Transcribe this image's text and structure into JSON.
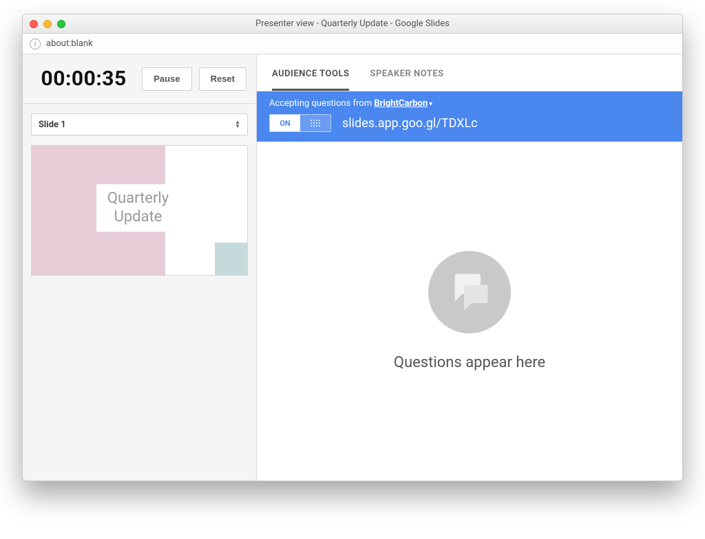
{
  "window": {
    "title": "Presenter view - Quarterly Update - Google Slides"
  },
  "addressbar": {
    "url": "about:blank"
  },
  "left": {
    "timer": "00:00:35",
    "pause_label": "Pause",
    "reset_label": "Reset",
    "slide_selector": "Slide 1",
    "thumbnail_title_line1": "Quarterly",
    "thumbnail_title_line2": "Update"
  },
  "tabs": {
    "audience": "AUDIENCE TOOLS",
    "notes": "SPEAKER NOTES"
  },
  "banner": {
    "accepting_prefix": "Accepting questions from",
    "organization": "BrightCarbon",
    "toggle_on": "ON",
    "share_url": "slides.app.goo.gl/TDXLc"
  },
  "questions": {
    "empty_text": "Questions appear here"
  }
}
